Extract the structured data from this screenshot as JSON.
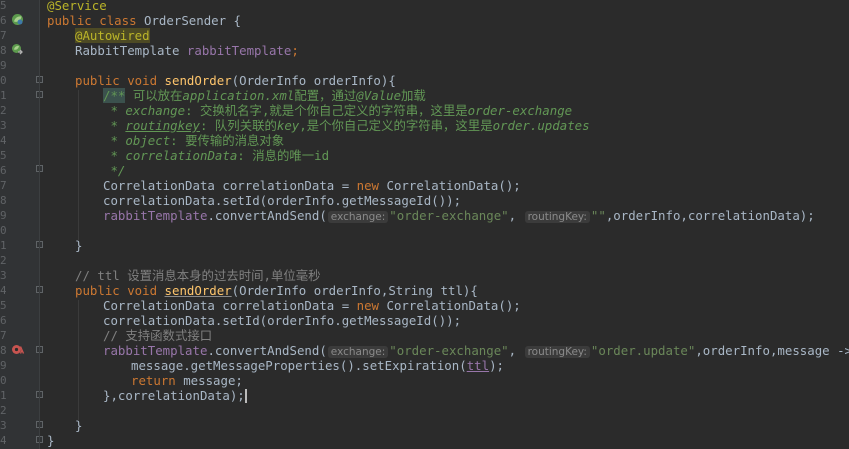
{
  "gutter": {
    "line_numbers": [
      "5",
      "6",
      "7",
      "8",
      "9",
      "0",
      "1",
      "2",
      "3",
      "4",
      "5",
      "6",
      "7",
      "8",
      "9",
      "0",
      "1",
      "2",
      "3",
      "4",
      "5",
      "6",
      "7",
      "8",
      "9",
      "0",
      "1",
      "2",
      "3",
      "4"
    ]
  },
  "code": {
    "l1": {
      "annotation": "@Service"
    },
    "l2": {
      "kw_public": "public",
      "kw_class": "class",
      "name": "OrderSender {"
    },
    "l3": {
      "annotation": "@Autowired"
    },
    "l4": {
      "type": "RabbitTemplate ",
      "field": "rabbitTemplate",
      "semi": ";"
    },
    "l6": {
      "kw": "public void ",
      "method": "sendOrder",
      "params": "(OrderInfo orderInfo){"
    },
    "l7": {
      "start": "/**",
      "text": " 可以放在",
      "italic": "application.xml",
      "text2": "配置，通过",
      "italic2": "@Value",
      "text3": "加载"
    },
    "l8": {
      "star": " * ",
      "tag": "exchange",
      "text": ": 交换机名字,就是个你自己定义的字符串，这里是",
      "italic": "order-exchange"
    },
    "l9": {
      "star": " * ",
      "tag": "routingkey",
      "text": ": 队列关联的",
      "italic": "key",
      "text2": ",是个你自己定义的字符串，这里是",
      "italic2": "order.updates"
    },
    "l10": {
      "star": " * ",
      "tag": "object",
      "text": ": 要传输的消息对象"
    },
    "l11": {
      "star": " * ",
      "tag": "correlationData",
      "text": ": 消息的唯一id"
    },
    "l12": {
      "end": " */"
    },
    "l13": {
      "text1": "CorrelationData correlationData = ",
      "kw": "new ",
      "text2": "CorrelationData();"
    },
    "l14": {
      "text": "correlationData.setId(orderInfo.getMessageId());"
    },
    "l15": {
      "field": "rabbitTemplate",
      "call": ".convertAndSend(",
      "hint1": "exchange:",
      "str1": "\"order-exchange\"",
      "comma1": ", ",
      "hint2": "routingKey:",
      "str2": "\"\"",
      "rest": ",orderInfo,correlationData);"
    },
    "l17": {
      "brace": "}"
    },
    "l19": {
      "comment": "// ttl 设置消息本身的过去时间,单位毫秒"
    },
    "l20": {
      "kw": "public void ",
      "method": "sendOrder",
      "params": "(OrderInfo orderInfo,String ttl){"
    },
    "l21": {
      "text1": "CorrelationData correlationData = ",
      "kw": "new ",
      "text2": "CorrelationData();"
    },
    "l22": {
      "text": "correlationData.setId(orderInfo.getMessageId());"
    },
    "l23": {
      "comment": "// 支持函数式接口"
    },
    "l24": {
      "field": "rabbitTemplate",
      "call": ".convertAndSend(",
      "hint1": "exchange:",
      "str1": "\"order-exchange\"",
      "comma1": ", ",
      "hint2": "routingKey:",
      "str2": "\"order.update\"",
      "rest": ",orderInfo,message -> {"
    },
    "l25": {
      "text1": "message.getMessageProperties().setExpiration(",
      "param": "ttl",
      "text2": ");"
    },
    "l26": {
      "kw": "return ",
      "text": "message;"
    },
    "l27": {
      "text": "},correlationData);"
    },
    "l29": {
      "brace": "}"
    },
    "l30": {
      "brace": "}"
    }
  },
  "colors": {
    "background": "#2b2b2b",
    "gutter": "#313335",
    "keyword": "#cc7832",
    "annotation": "#bbb529",
    "method": "#ffc66d",
    "field": "#9876aa",
    "string": "#6a8759",
    "comment": "#808080",
    "javadoc": "#629755",
    "text": "#a9b7c6"
  },
  "icons": [
    "spring-bean-icon",
    "autowired-icon",
    "breakpoint-lambda-icon",
    "fold-marker-icon"
  ]
}
